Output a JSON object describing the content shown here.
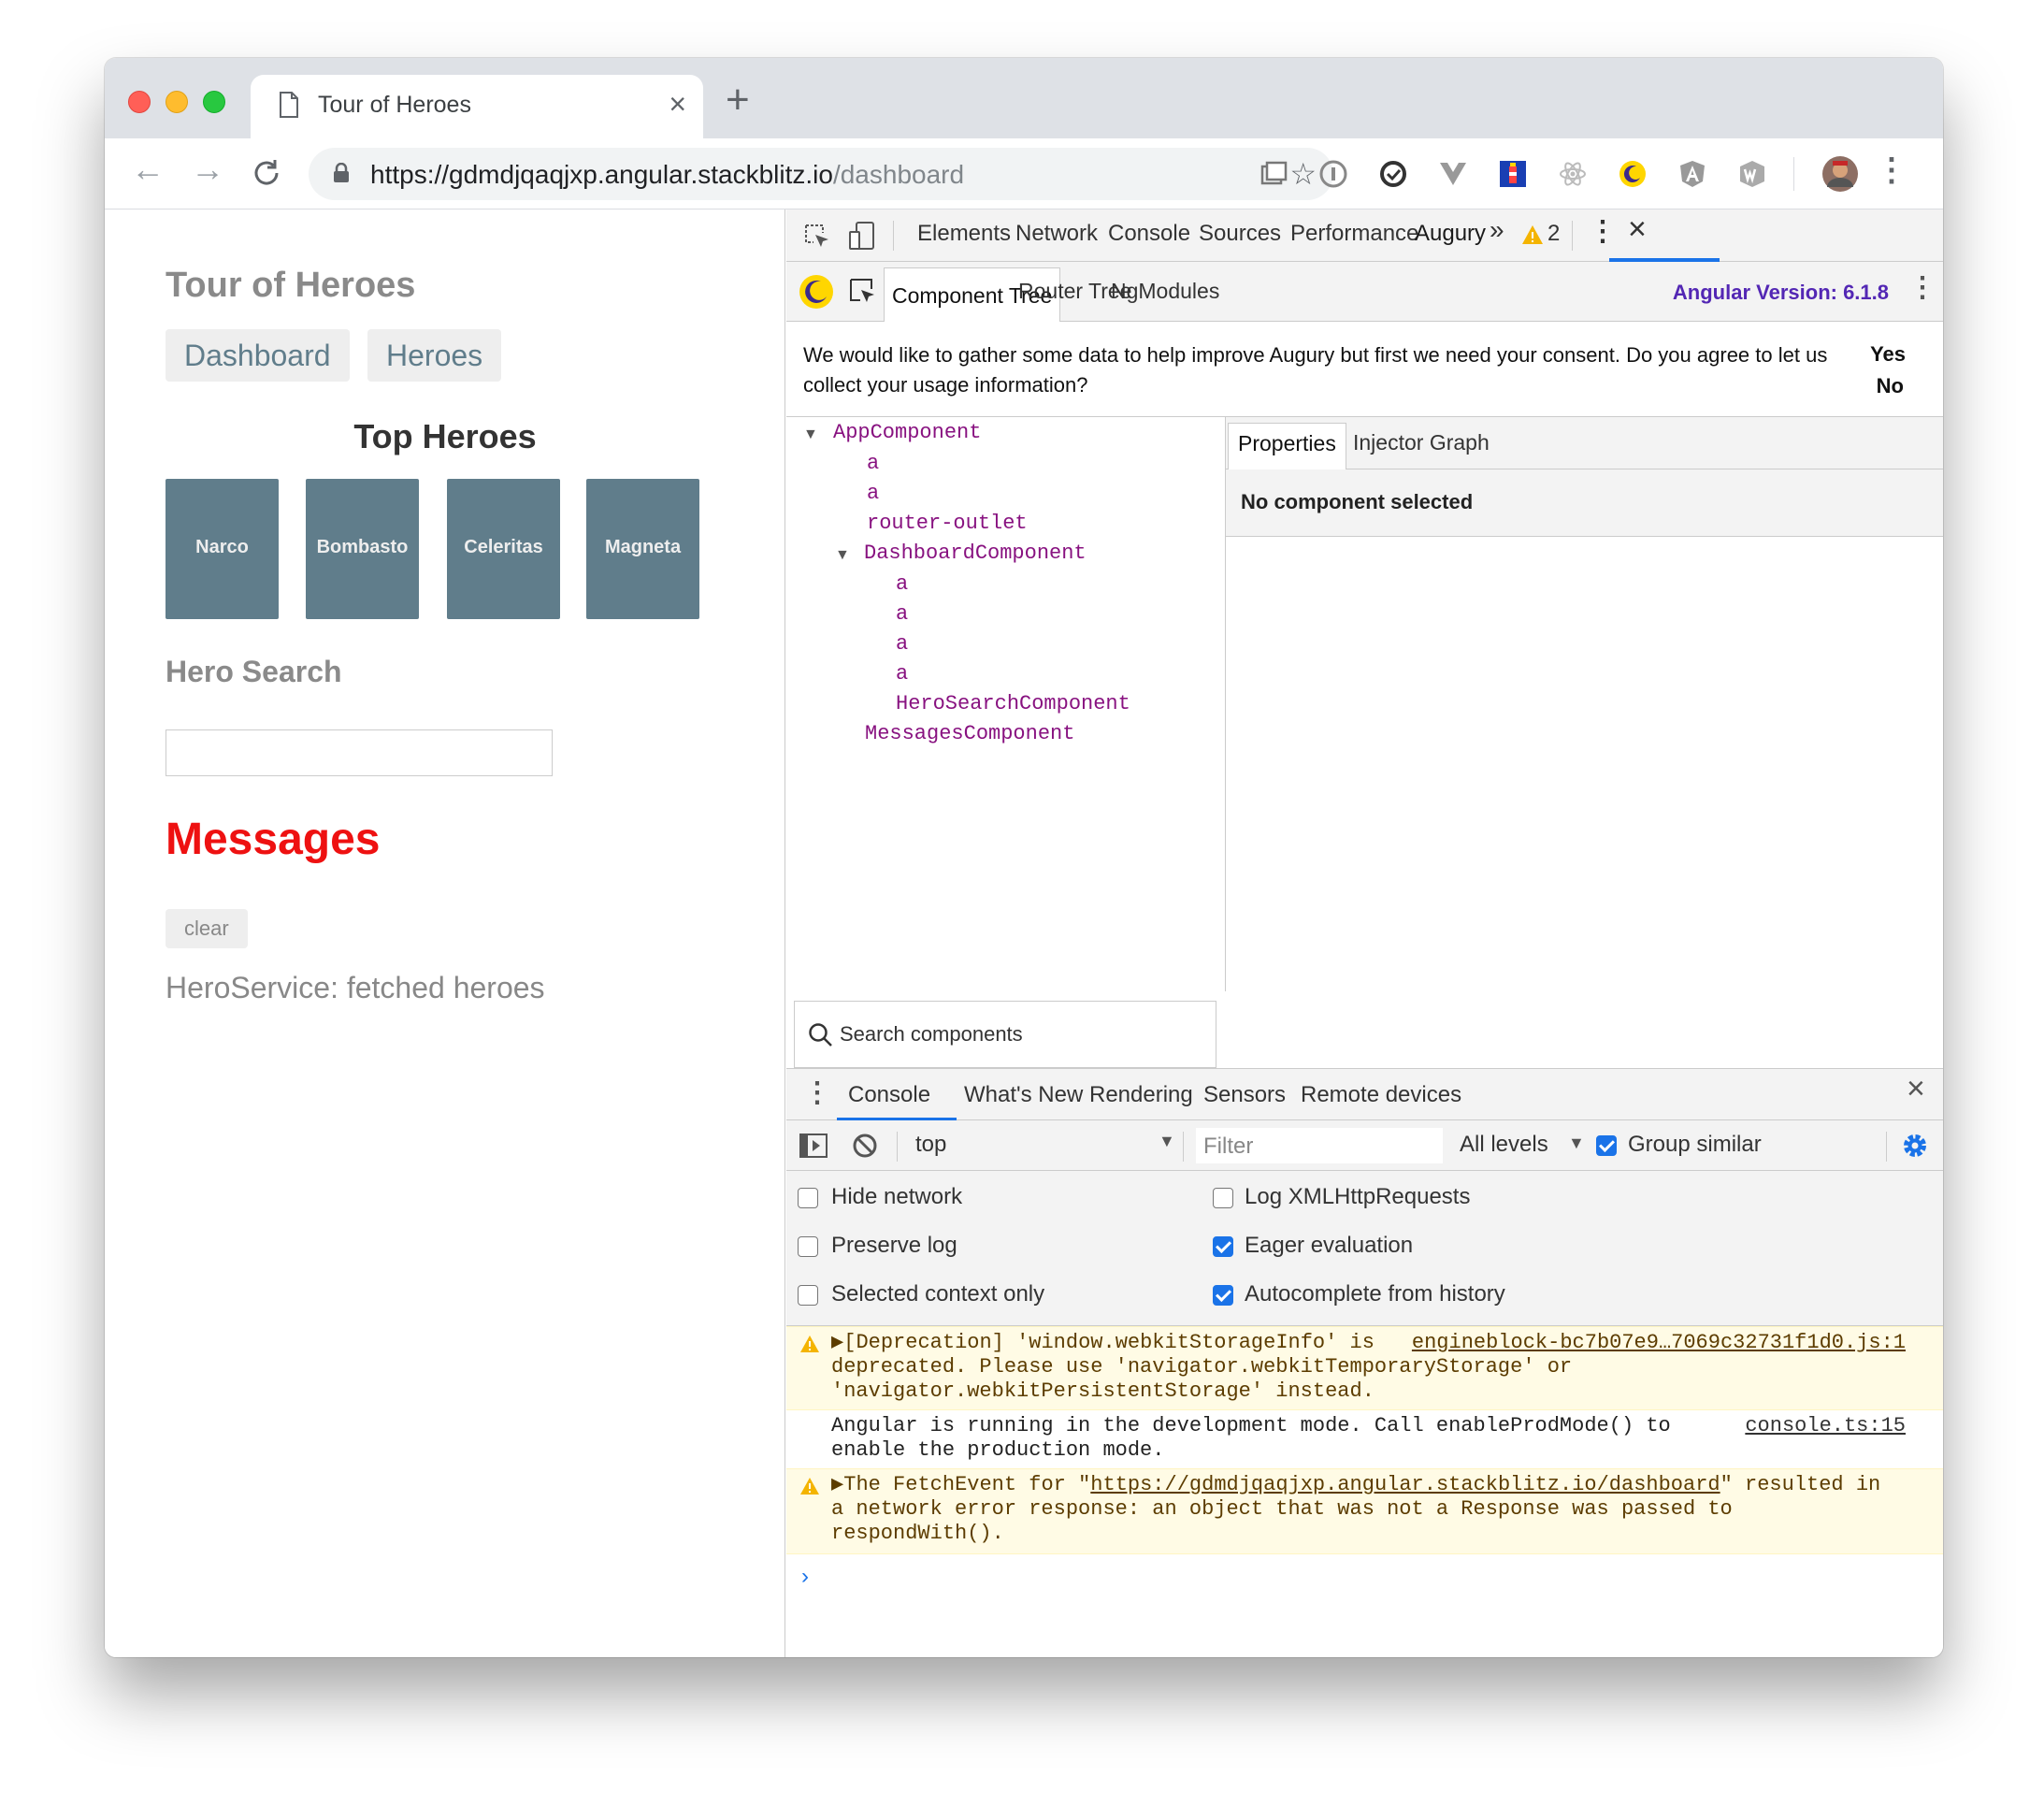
{
  "browser": {
    "tab_title": "Tour of Heroes",
    "tab_close": "×",
    "new_tab": "+",
    "url_host": "https://gdmdjqaqjxp.angular.stackblitz.io",
    "url_path": "/dashboard"
  },
  "page": {
    "app_title": "Tour of Heroes",
    "nav": [
      "Dashboard",
      "Heroes"
    ],
    "top_heroes_title": "Top Heroes",
    "heroes": [
      "Narco",
      "Bombasto",
      "Celeritas",
      "Magneta"
    ],
    "hero_search_title": "Hero Search",
    "search_value": "",
    "messages_title": "Messages",
    "clear_label": "clear",
    "message": "HeroService: fetched heroes"
  },
  "devtools": {
    "tabs": [
      "Elements",
      "Network",
      "Console",
      "Sources",
      "Performance",
      "Augury"
    ],
    "active_tab": "Augury",
    "more": "»",
    "warning_count": "2",
    "close": "×",
    "augury": {
      "tabs": [
        "Component Tree",
        "Router Tree",
        "NgModules"
      ],
      "version": "Angular Version: 6.1.8",
      "consent_text": "We would like to gather some data to help improve Augury but first we need your consent. Do you agree to let us collect your usage information?",
      "consent_yes": "Yes",
      "consent_no": "No",
      "tree": [
        "AppComponent",
        "a",
        "a",
        "router-outlet",
        "DashboardComponent",
        "a",
        "a",
        "a",
        "a",
        "HeroSearchComponent",
        "MessagesComponent"
      ],
      "search_placeholder": "Search components",
      "props_tabs": [
        "Properties",
        "Injector Graph"
      ],
      "no_selection": "No component selected"
    },
    "drawer": {
      "tabs": [
        "Console",
        "What's New",
        "Rendering",
        "Sensors",
        "Remote devices"
      ],
      "context": "top",
      "filter_placeholder": "Filter",
      "levels": "All levels",
      "group_similar": "Group similar",
      "group_similar_checked": true,
      "settings": [
        {
          "label": "Hide network",
          "checked": false
        },
        {
          "label": "Log XMLHttpRequests",
          "checked": false
        },
        {
          "label": "Preserve log",
          "checked": false
        },
        {
          "label": "Eager evaluation",
          "checked": true
        },
        {
          "label": "Selected context only",
          "checked": false
        },
        {
          "label": "Autocomplete from history",
          "checked": true
        }
      ],
      "logs": {
        "w1_line1": "▶[Deprecation] 'window.webkitStorageInfo' is",
        "w1_line2": "deprecated. Please use 'navigator.webkitTemporaryStorage' or",
        "w1_line3": "'navigator.webkitPersistentStorage' instead.",
        "w1_source": "engineblock-bc7b07e9…7069c32731f1d0.js:1",
        "i1_line1": "Angular is running in the development mode. Call enableProdMode() to",
        "i1_line2": "enable the production mode.",
        "i1_source": "console.ts:15",
        "w2_pre": "▶The FetchEvent for \"",
        "w2_url": "https://gdmdjqaqjxp.angular.stackblitz.io/dashboard",
        "w2_post": "\" resulted in",
        "w2_line2": "a network error response: an object that was not a Response was passed to",
        "w2_line3": "respondWith()."
      },
      "prompt": "›"
    }
  },
  "colors": {
    "hero_tile": "#607d8b",
    "messages": "#ee1111",
    "accent": "#1a73e8",
    "augury_version": "#5327b4",
    "tree_node": "#881280"
  }
}
